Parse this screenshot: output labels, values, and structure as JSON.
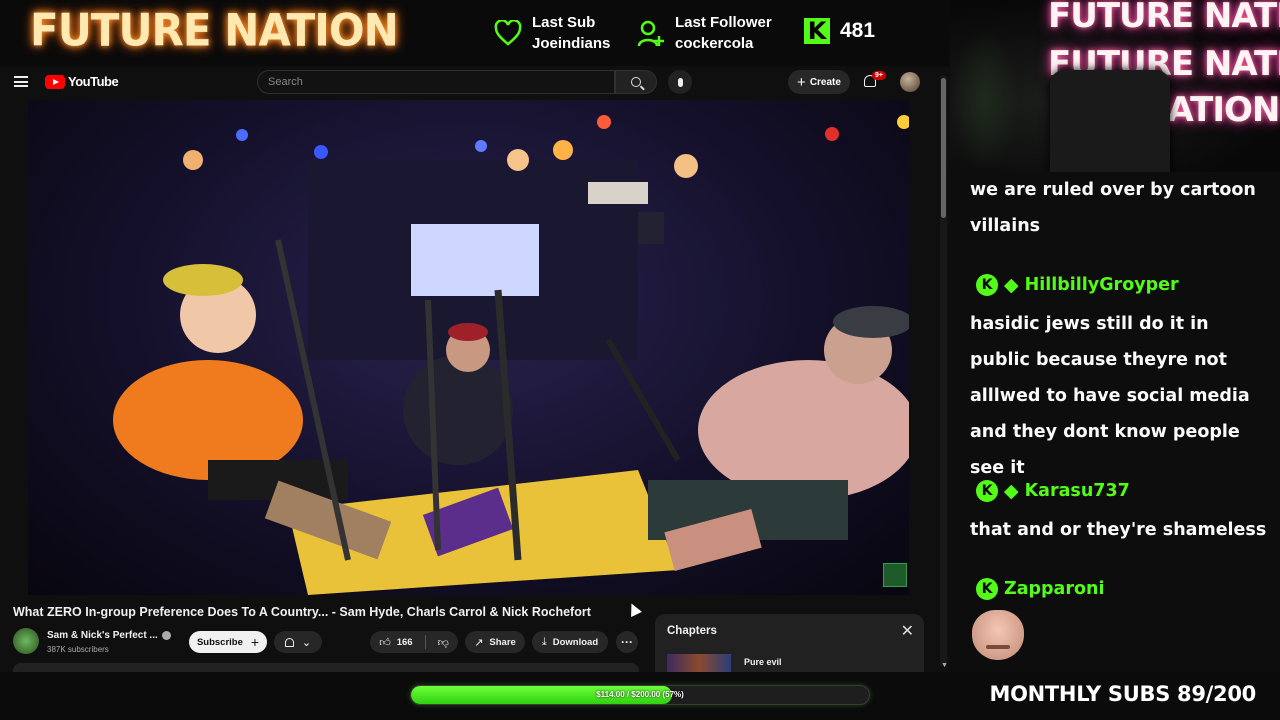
{
  "overlay": {
    "brand": "FUTURE NATION",
    "last_sub_label": "Last Sub",
    "last_sub_name": "Joeindians",
    "last_follower_label": "Last Follower",
    "last_follower_name": "cockercola",
    "kick_logo": "K",
    "kick_viewers": "481",
    "colors": {
      "accent_green": "#53fc18",
      "neon_orange": "#ff9a3c"
    }
  },
  "youtube": {
    "logo_text": "YouTube",
    "search_placeholder": "Search",
    "create_label": "Create",
    "notification_badge": "9+",
    "video_title": "What ZERO In-group Preference Does To A Country... - Sam Hyde, Charls Carrol & Nick Rochefort",
    "channel_name": "Sam & Nick's Perfect ...",
    "subscriber_count": "387K subscribers",
    "subscribe_label": "Subscribe",
    "like_count": "166",
    "share_label": "Share",
    "download_label": "Download",
    "more_label": "···",
    "chapters_title": "Chapters",
    "chapter_item": "Pure evil",
    "icons": [
      "menu-icon",
      "search-icon",
      "mic-icon",
      "plus-icon",
      "bell-icon",
      "like-icon",
      "dislike-icon",
      "share-icon",
      "download-icon",
      "close-icon"
    ]
  },
  "chat": {
    "cam_neon_lines": [
      "FUTURE NATION",
      "FUTURE NATION",
      "NATION"
    ],
    "badge_letter": "K",
    "messages": [
      {
        "user": "",
        "text": "we are ruled over by cartoon villains"
      },
      {
        "user": "HillbillyGroyper",
        "text": "hasidic jews still do it in public because theyre not alllwed to have social media and they dont know people see it"
      },
      {
        "user": "Karasu737",
        "text": "that and or they're shameless"
      },
      {
        "user": "Zapparoni",
        "text": ""
      }
    ]
  },
  "bottom": {
    "goal_text": "$114.00 / $200.00 (57%)",
    "goal_fraction": 0.57,
    "monthly_subs": "MONTHLY SUBS 89/200"
  }
}
